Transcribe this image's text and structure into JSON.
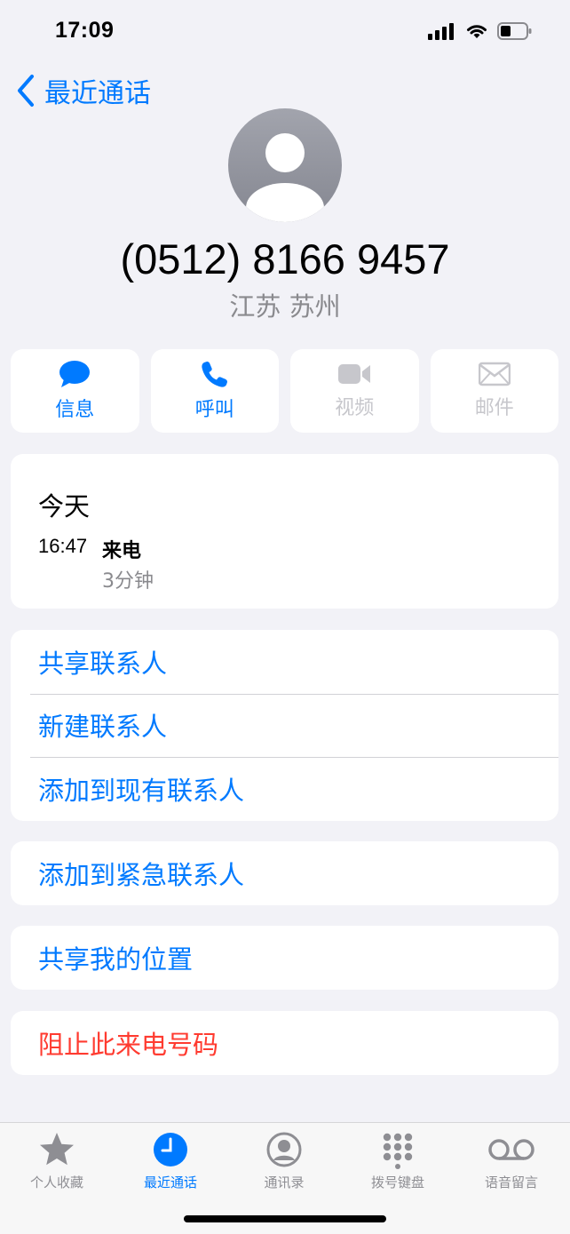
{
  "status": {
    "time": "17:09"
  },
  "nav": {
    "back_label": "最近通话"
  },
  "contact": {
    "phone_number": "(0512) 8166 9457",
    "location": "江苏 苏州"
  },
  "actions": [
    {
      "label": "信息",
      "icon": "message-bubble-icon",
      "enabled": true
    },
    {
      "label": "呼叫",
      "icon": "phone-icon",
      "enabled": true
    },
    {
      "label": "视频",
      "icon": "video-camera-icon",
      "enabled": false
    },
    {
      "label": "邮件",
      "icon": "envelope-icon",
      "enabled": false
    }
  ],
  "history": {
    "day": "今天",
    "entries": [
      {
        "time": "16:47",
        "type": "来电",
        "duration": "3分钟"
      }
    ]
  },
  "options_group1": [
    "共享联系人",
    "新建联系人",
    "添加到现有联系人"
  ],
  "options_group2": [
    "添加到紧急联系人"
  ],
  "options_group3": [
    "共享我的位置"
  ],
  "options_group4": [
    "阻止此来电号码"
  ],
  "tabs": [
    {
      "label": "个人收藏",
      "icon": "star-icon",
      "active": false
    },
    {
      "label": "最近通话",
      "icon": "clock-icon",
      "active": true
    },
    {
      "label": "通讯录",
      "icon": "person-circle-icon",
      "active": false
    },
    {
      "label": "拨号键盘",
      "icon": "keypad-icon",
      "active": false
    },
    {
      "label": "语音留言",
      "icon": "voicemail-icon",
      "active": false
    }
  ],
  "colors": {
    "accent": "#007aff",
    "danger": "#ff3b30",
    "background": "#f2f2f7",
    "secondary_text": "#8a8a8e"
  }
}
